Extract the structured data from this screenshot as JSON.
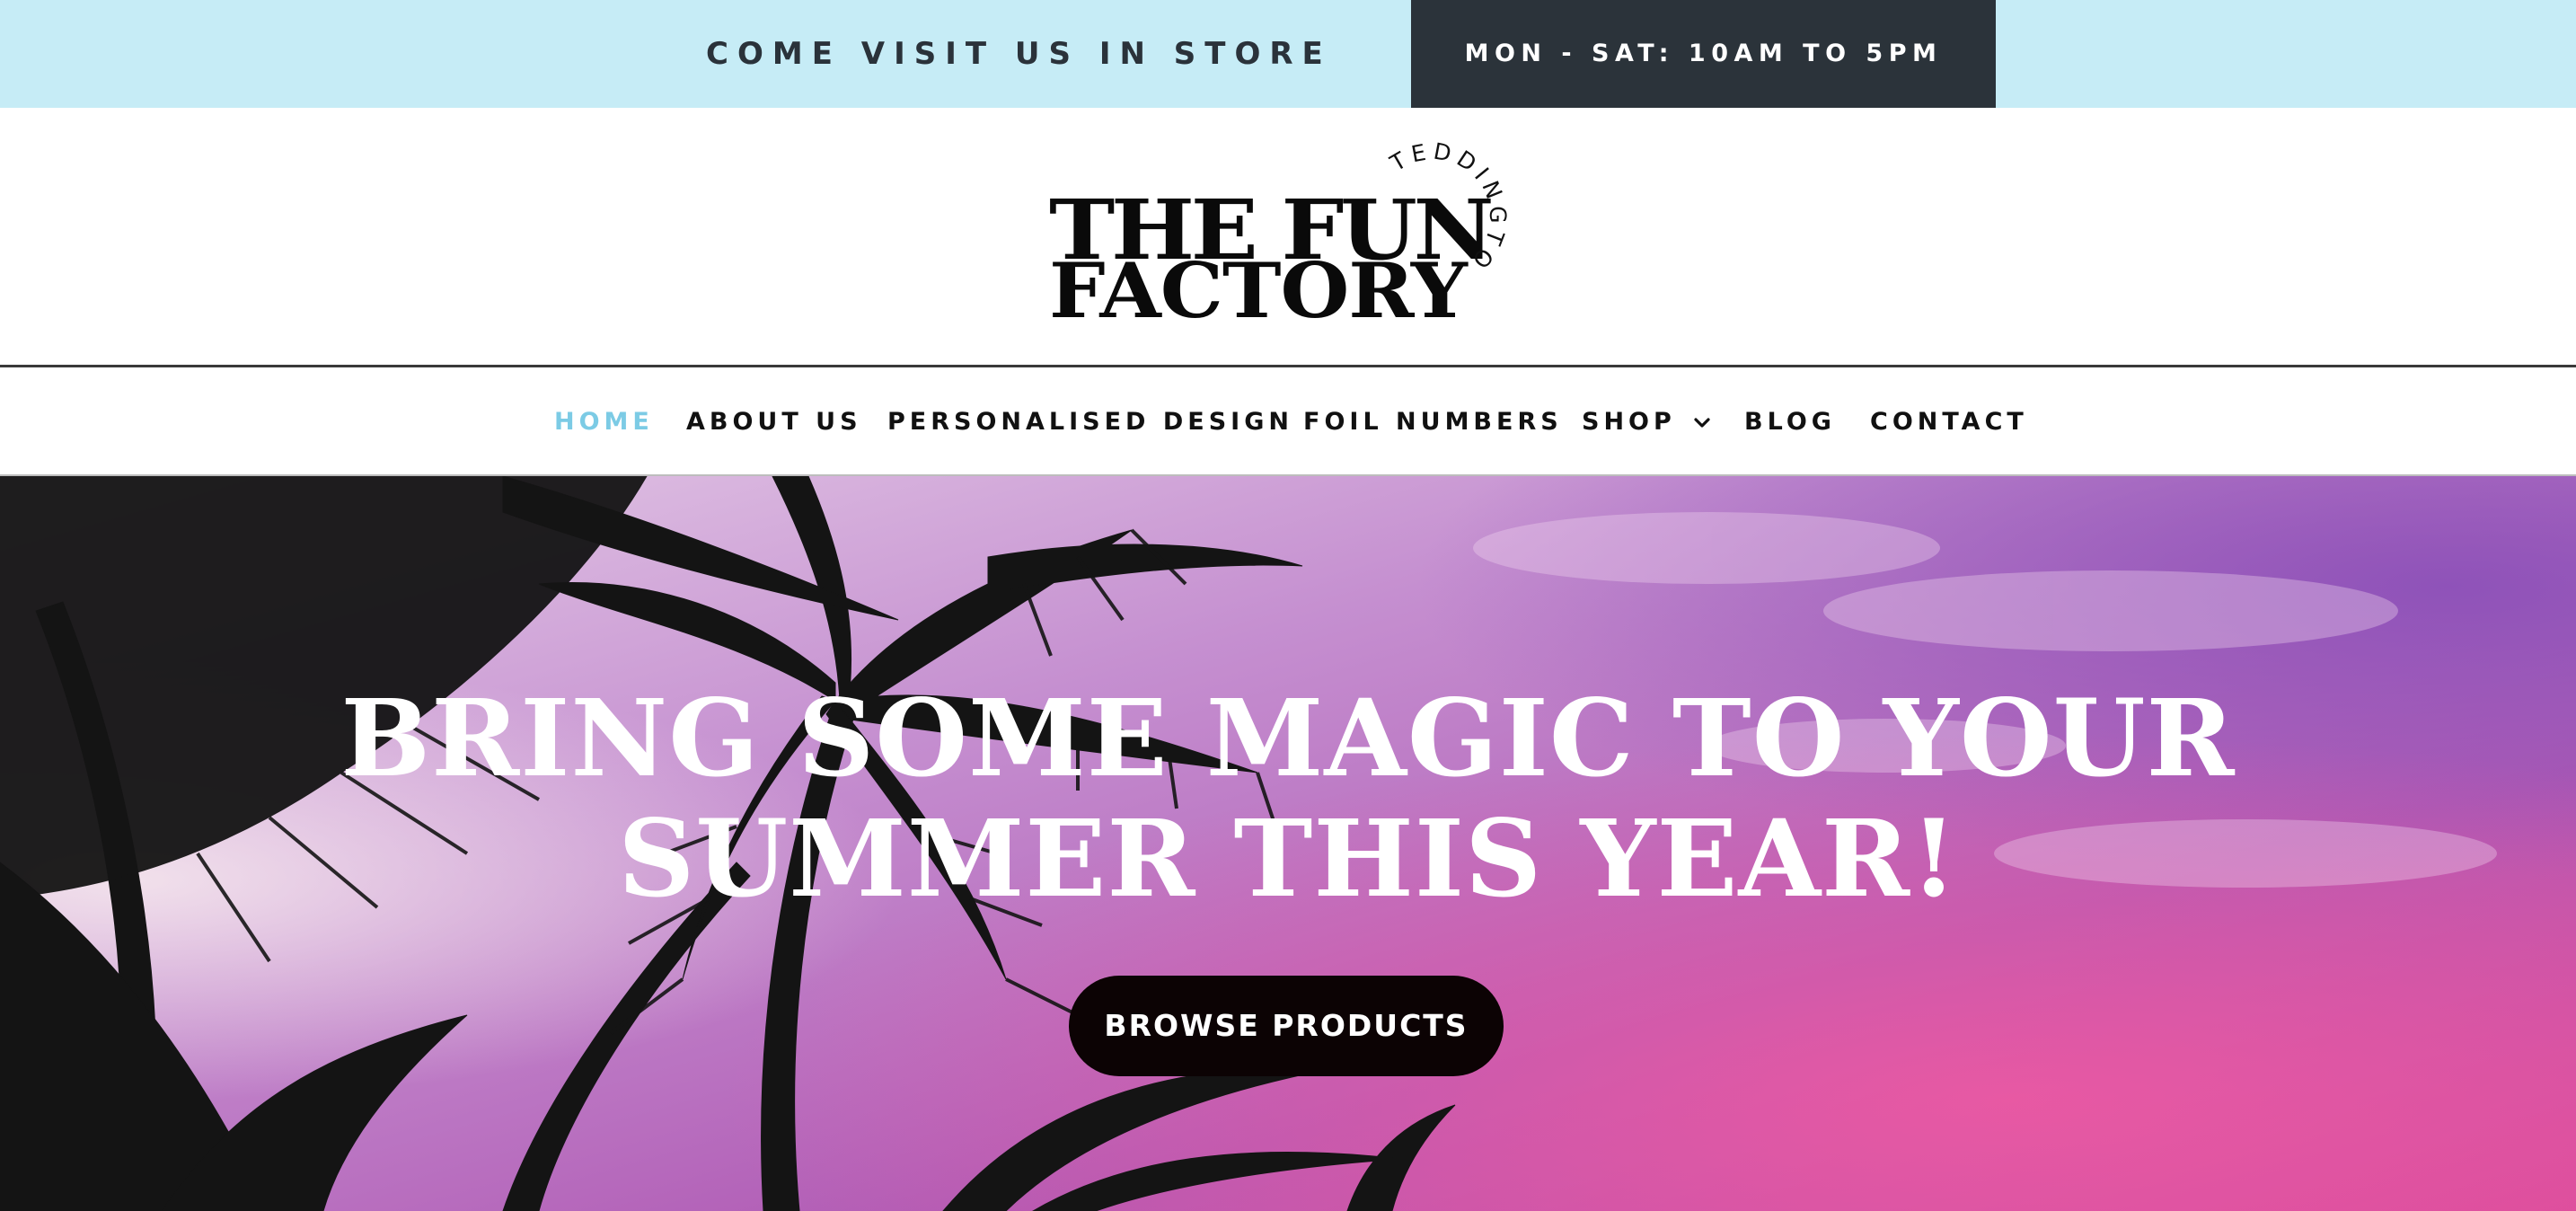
{
  "topbar": {
    "visit_text": "COME VISIT US IN STORE",
    "hours_text": "MON - SAT: 10AM TO 5PM"
  },
  "logo": {
    "line1": "THE FUN",
    "line2": "FACTORY",
    "arc_text": "TEDDINGTON"
  },
  "nav": {
    "items": [
      {
        "label": "HOME",
        "active": true
      },
      {
        "label": "ABOUT US"
      },
      {
        "label": "PERSONALISED DESIGN"
      },
      {
        "label": "FOIL NUMBERS"
      },
      {
        "label": "SHOP",
        "has_dropdown": true
      },
      {
        "label": "BLOG"
      },
      {
        "label": "CONTACT"
      }
    ],
    "active_color": "#7ccbe5"
  },
  "hero": {
    "title_line1": "BRING SOME MAGIC TO YOUR",
    "title_line2": "SUMMER THIS YEAR!",
    "cta_label": "BROWSE PRODUCTS"
  },
  "colors": {
    "topbar_bg": "#c6ecf6",
    "hours_bg": "#2b333a",
    "cta_bg": "#0c0304"
  }
}
